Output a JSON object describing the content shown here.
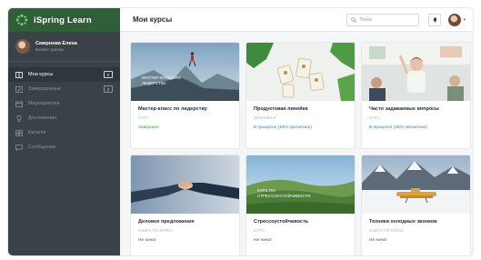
{
  "app": {
    "brand": "iSpring Learn"
  },
  "user": {
    "name": "Смирнова Елена",
    "role": "Бизнес-тренер"
  },
  "sidebar": {
    "items": [
      {
        "label": "Мои курсы",
        "badge": "8",
        "icon": "book-icon"
      },
      {
        "label": "Завершенные",
        "badge": "2",
        "icon": "check-list-icon"
      },
      {
        "label": "Мероприятия",
        "badge": "",
        "icon": "calendar-icon"
      },
      {
        "label": "Достижения",
        "badge": "",
        "icon": "trophy-icon"
      },
      {
        "label": "Каталог",
        "badge": "",
        "icon": "catalog-icon"
      },
      {
        "label": "Сообщения",
        "badge": "",
        "icon": "message-icon"
      }
    ]
  },
  "header": {
    "title": "Мои курсы",
    "search_placeholder": "Поиск"
  },
  "cards": [
    {
      "title": "Мастер-класс по лидерству",
      "type": "курс",
      "status": "Завершен",
      "status_color": "#3c9b46",
      "overlay": "Мастер-класс по лидерству",
      "image": "mountain-hiker"
    },
    {
      "title": "Продуктовая линейка",
      "type": "документ",
      "status": "В процессе (16% прочитано)",
      "status_color": "#3c78b8",
      "overlay": "",
      "image": "product-boxes"
    },
    {
      "title": "Часто задаваемые вопросы",
      "type": "курс",
      "status": "В процессе (25% прочитано)",
      "status_color": "#3c78b8",
      "overlay": "",
      "image": "office-team"
    },
    {
      "title": "Деловое предложение",
      "type": "книга по курсу",
      "status": "Не начат",
      "status_color": "#4a5055",
      "overlay": "",
      "image": "handshake"
    },
    {
      "title": "Стрессоустойчивость",
      "type": "курс",
      "status": "Не начат",
      "status_color": "#4a5055",
      "overlay": "Курс по стрессоустойчивости",
      "image": "green-hills"
    },
    {
      "title": "Техники холодных звонков",
      "type": "книга по курсу",
      "status": "Не начат",
      "status_color": "#4a5055",
      "overlay": "",
      "image": "airplane-snow"
    }
  ]
}
